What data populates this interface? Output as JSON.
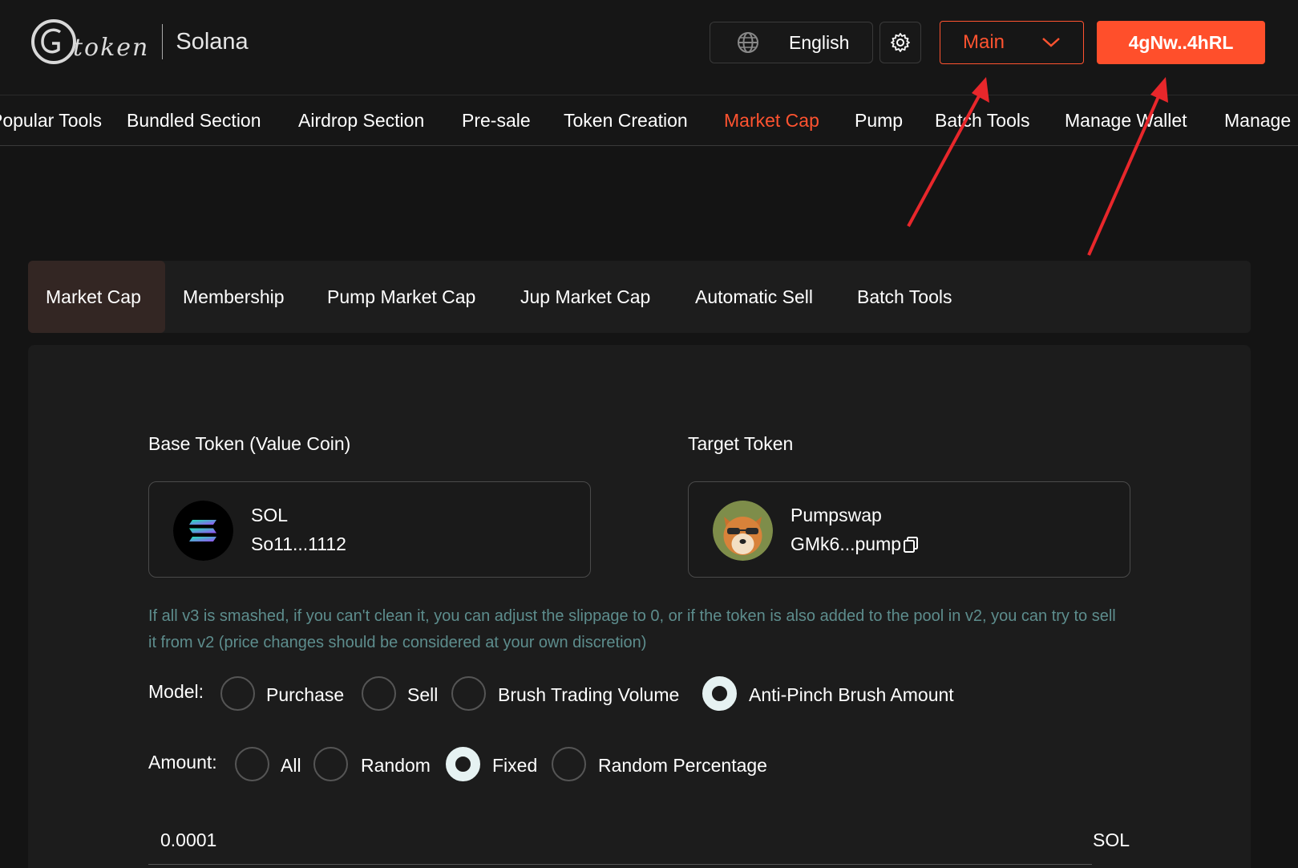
{
  "header": {
    "logo_text": "token",
    "chain": "Solana",
    "language": "English",
    "network": "Main",
    "wallet": "4gNw..4hRL"
  },
  "nav": {
    "items": [
      "Popular Tools",
      "Bundled Section",
      "Airdrop Section",
      "Pre-sale",
      "Token Creation",
      "Market Cap",
      "Pump",
      "Batch Tools",
      "Manage Wallet",
      "Manage"
    ],
    "active": "Market Cap"
  },
  "tabs": {
    "items": [
      "Market Cap",
      "Membership",
      "Pump Market Cap",
      "Jup Market Cap",
      "Automatic Sell",
      "Batch Tools"
    ],
    "active": "Market Cap"
  },
  "base_token": {
    "label": "Base Token (Value Coin)",
    "name": "SOL",
    "address": "So11...1112"
  },
  "target_token": {
    "label": "Target Token",
    "name": "Pumpswap",
    "address": "GMk6...pump"
  },
  "note": "If all v3 is smashed, if you can't clean it, you can adjust the slippage to 0, or if the token is also added to the pool in v2, you can try to sell it from v2 (price changes should be considered at your own discretion)",
  "model": {
    "label": "Model:",
    "options": [
      "Purchase",
      "Sell",
      "Brush Trading Volume",
      "Anti-Pinch Brush Amount"
    ],
    "selected": "Anti-Pinch Brush Amount"
  },
  "amount": {
    "label": "Amount:",
    "options": [
      "All",
      "Random",
      "Fixed",
      "Random Percentage"
    ],
    "selected": "Fixed",
    "value": "0.0001",
    "unit": "SOL"
  },
  "colors": {
    "accent": "#ff5330",
    "background": "#141414",
    "card": "#1c1c1c",
    "note_text": "#5d8d8d",
    "annotation_arrow": "#e8272b"
  }
}
